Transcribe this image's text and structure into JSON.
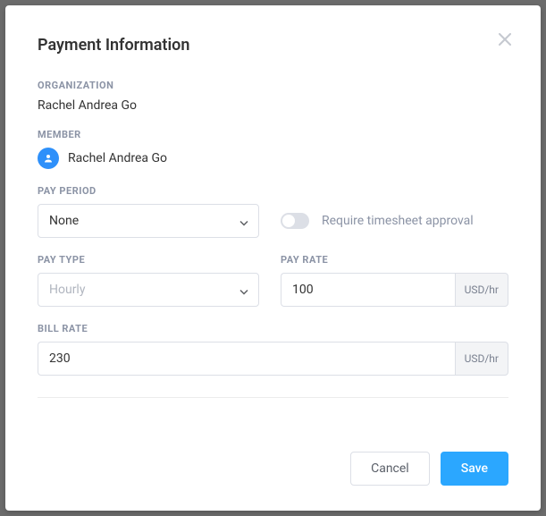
{
  "modal": {
    "title": "Payment Information"
  },
  "organization": {
    "label": "Organization",
    "value": "Rachel Andrea Go"
  },
  "member": {
    "label": "Member",
    "value": "Rachel Andrea Go"
  },
  "pay_period": {
    "label": "Pay Period",
    "value": "None"
  },
  "timesheet_approval": {
    "label": "Require timesheet approval",
    "enabled": false
  },
  "pay_type": {
    "label": "Pay Type",
    "placeholder": "Hourly",
    "value": ""
  },
  "pay_rate": {
    "label": "Pay Rate",
    "value": "100",
    "suffix": "USD/hr"
  },
  "bill_rate": {
    "label": "Bill Rate",
    "value": "230",
    "suffix": "USD/hr"
  },
  "footer": {
    "cancel": "Cancel",
    "save": "Save"
  }
}
